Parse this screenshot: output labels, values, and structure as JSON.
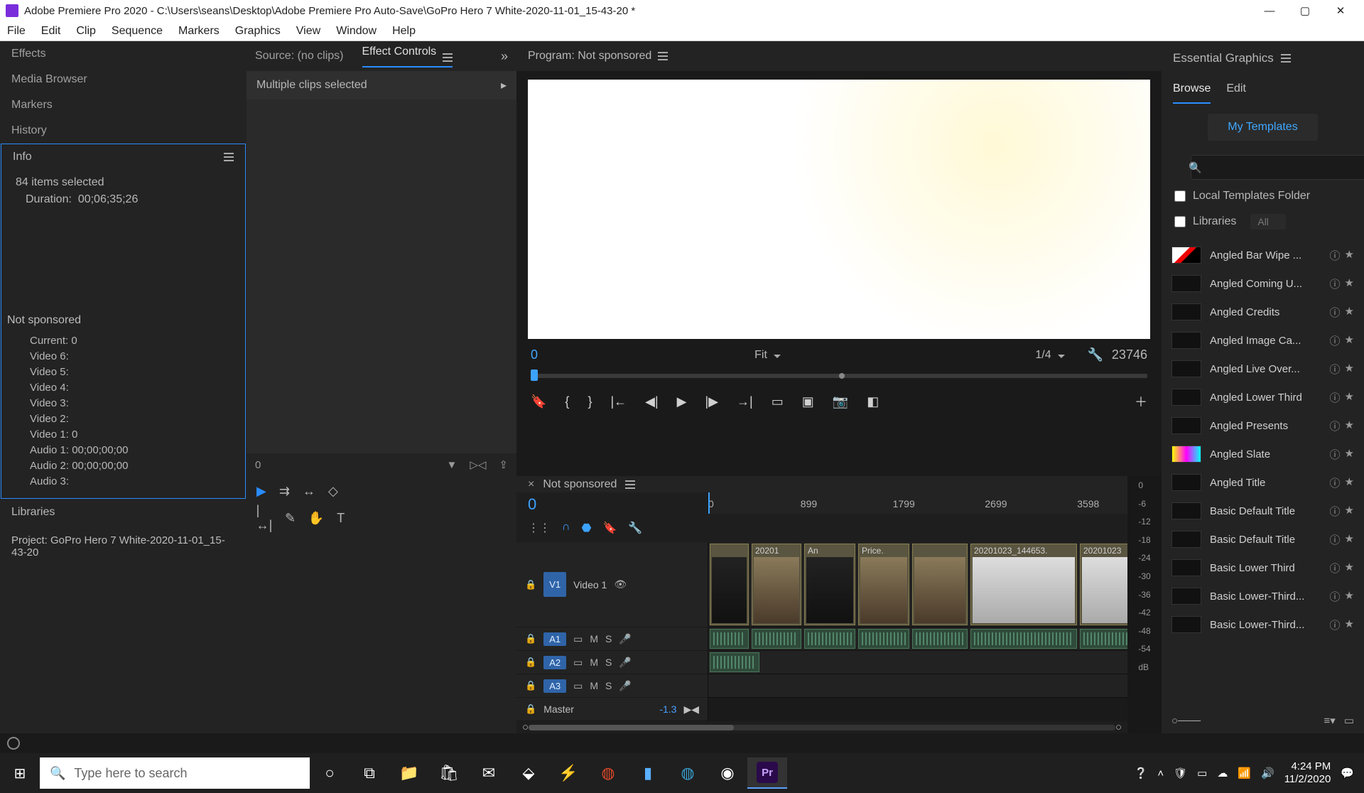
{
  "titlebar": {
    "app": "Adobe Premiere Pro 2020",
    "path": "C:\\Users\\seans\\Desktop\\Adobe Premiere Pro Auto-Save\\GoPro Hero 7 White-2020-11-01_15-43-20 *"
  },
  "menu": [
    "File",
    "Edit",
    "Clip",
    "Sequence",
    "Markers",
    "Graphics",
    "View",
    "Window",
    "Help"
  ],
  "left": {
    "tabs": [
      "Effects",
      "Media Browser",
      "Markers",
      "History",
      "Info"
    ],
    "info": {
      "items_selected": "84 items selected",
      "duration_label": "Duration:",
      "duration": "00;06;35;26"
    },
    "sequence_name": "Not sponsored",
    "tracks": {
      "current": "Current:  0",
      "video": [
        "Video 6:",
        "Video 5:",
        "Video 4:",
        "Video 3:",
        "Video 2:",
        "Video 1:  0"
      ],
      "audio": [
        "Audio 1:  00;00;00;00",
        "Audio 2:  00;00;00;00",
        "Audio 3:"
      ]
    },
    "libraries": "Libraries",
    "project": "Project: GoPro Hero 7 White-2020-11-01_15-43-20"
  },
  "mid": {
    "source_tab": "Source: (no clips)",
    "ec_tab": "Effect Controls",
    "multi_sel": "Multiple clips selected",
    "timecode_zero": "0"
  },
  "program": {
    "header": "Program: Not sponsored",
    "tc": "0",
    "fit": "Fit",
    "res": "1/4",
    "dur": "23746"
  },
  "timeline": {
    "name": "Not sponsored",
    "tc": "0",
    "ruler": [
      "0",
      "899",
      "1799",
      "2699",
      "3598"
    ],
    "v1_label": "V1",
    "v1_name": "Video 1",
    "a_labels": [
      "A1",
      "A2",
      "A3"
    ],
    "master": "Master",
    "master_gain": "-1.3",
    "clips": [
      "",
      "20201",
      "An",
      "Price.",
      "",
      "20201023_144653.",
      "20201023"
    ]
  },
  "meters": [
    "0",
    "-6",
    "-12",
    "-18",
    "-24",
    "-30",
    "-36",
    "-42",
    "-48",
    "-54",
    "dB"
  ],
  "right": {
    "title": "Essential Graphics",
    "tabs": [
      "Browse",
      "Edit"
    ],
    "my_templates": "My Templates",
    "local_folder": "Local Templates Folder",
    "libraries": "Libraries",
    "lib_all": "All",
    "templates": [
      "Angled Bar Wipe ...",
      "Angled Coming U...",
      "Angled Credits",
      "Angled Image Ca...",
      "Angled Live Over...",
      "Angled Lower Third",
      "Angled Presents",
      "Angled Slate",
      "Angled Title",
      "Basic Default Title",
      "Basic Default Title",
      "Basic Lower Third",
      "Basic Lower-Third...",
      "Basic Lower-Third..."
    ]
  },
  "taskbar": {
    "search_placeholder": "Type here to search",
    "time": "4:24 PM",
    "date": "11/2/2020"
  }
}
